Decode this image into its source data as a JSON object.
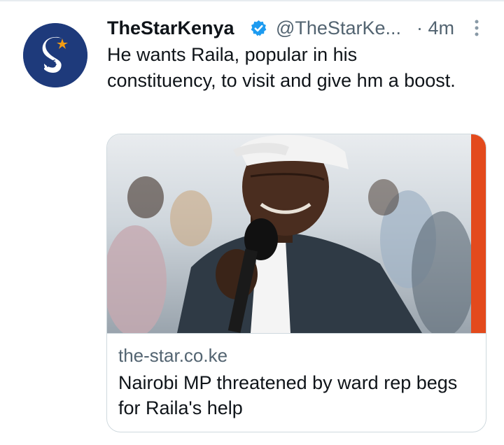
{
  "tweet": {
    "author_name": "TheStarKenya",
    "handle": "@TheStarKe...",
    "time": "· 4m",
    "text": "He wants Raila, popular in his constituency, to visit and give hm a boost.",
    "avatar_icon": "the-star-logo-icon",
    "verified_icon": "verified-badge-icon",
    "more_icon": "more-options-icon"
  },
  "card": {
    "domain": "the-star.co.ke",
    "title": "Nairobi MP threatened by ward rep begs for Raila's help",
    "image_icon": "news-photo-image"
  },
  "colors": {
    "verified_blue": "#1d9bf0",
    "avatar_bg": "#1e3a7b",
    "muted_text": "#536471"
  }
}
